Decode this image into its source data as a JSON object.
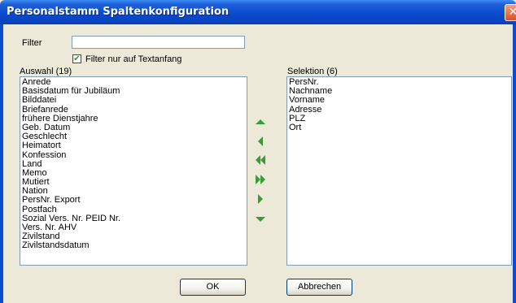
{
  "window": {
    "title": "Personalstamm Spaltenkonfiguration",
    "close_glyph": "✕"
  },
  "filter": {
    "label": "Filter",
    "value": "",
    "checkbox_label": "Filter nur auf Textanfang",
    "checkbox_checked": true,
    "checkbox_glyph": "✔"
  },
  "auswahl": {
    "header": "Auswahl (19)",
    "items": [
      "Anrede",
      "Basisdatum für Jubiläum",
      "Bilddatei",
      "Briefanrede",
      "frühere Dienstjahre",
      "Geb. Datum",
      "Geschlecht",
      "Heimatort",
      "Konfession",
      "Land",
      "Memo",
      "Mutiert",
      "Nation",
      "PersNr. Export",
      "Postfach",
      "Sozial Vers. Nr. PEID Nr.",
      "Vers. Nr. AHV",
      "Zivilstand",
      "Zivilstandsdatum"
    ]
  },
  "selektion": {
    "header": "Selektion (6)",
    "items": [
      "PersNr.",
      "Nachname",
      "Vorname",
      "Adresse",
      "PLZ",
      "Ort"
    ]
  },
  "arrows": [
    {
      "name": "move-up-icon",
      "color": "#3a9a3a"
    },
    {
      "name": "move-left-icon",
      "color": "#3a9a3a"
    },
    {
      "name": "move-all-left-icon",
      "color": "#3a9a3a"
    },
    {
      "name": "move-all-right-icon",
      "color": "#3a9a3a"
    },
    {
      "name": "move-right-icon",
      "color": "#3a9a3a"
    },
    {
      "name": "move-down-icon",
      "color": "#3a9a3a"
    }
  ],
  "buttons": {
    "ok": "OK",
    "cancel": "Abbrechen"
  }
}
